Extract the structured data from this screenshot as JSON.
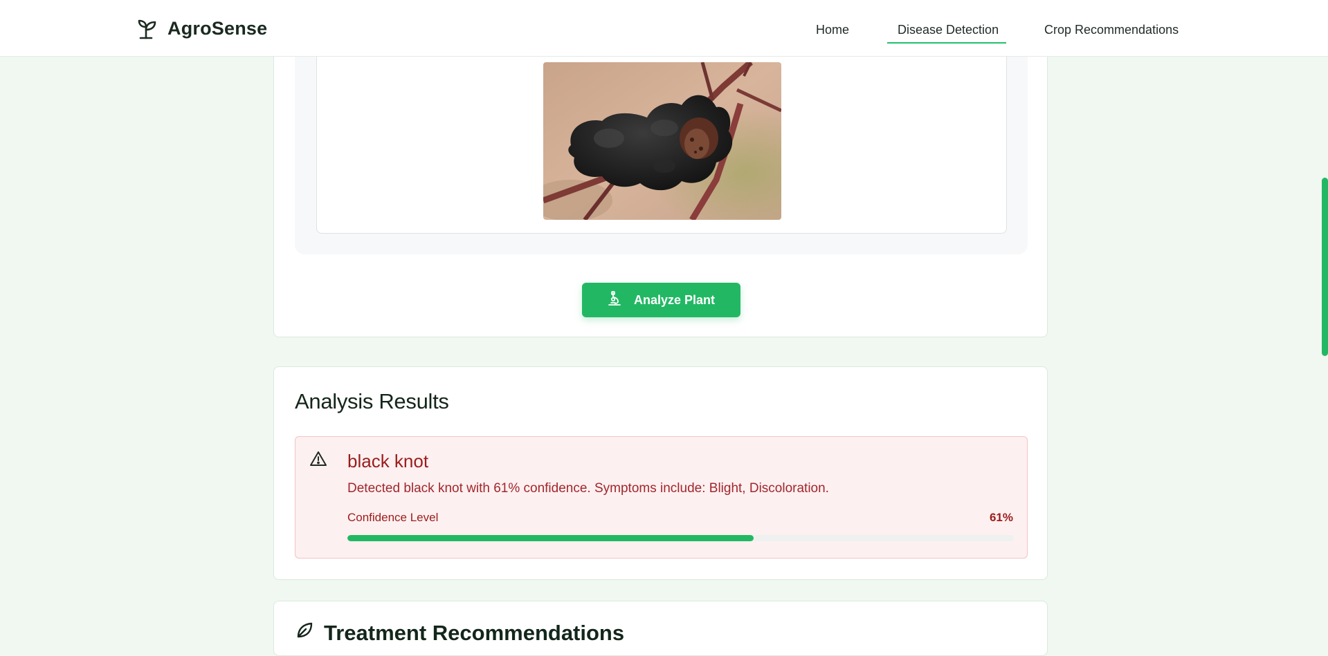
{
  "navbar": {
    "brand": "AgroSense",
    "links": [
      {
        "label": "Home"
      },
      {
        "label": "Disease Detection",
        "active": true
      },
      {
        "label": "Crop Recommendations"
      }
    ]
  },
  "upload": {
    "preview_alt": "black knot plant image",
    "analyze_button": "Analyze Plant",
    "analyze_icon": "microscope-icon"
  },
  "results": {
    "title": "Analysis Results",
    "alert_icon": "warning-triangle-icon",
    "disease_name": "black knot",
    "description": "Detected black knot with 61% confidence. Symptoms include: Blight, Discoloration.",
    "confidence_label": "Confidence Level",
    "confidence_text": "61%",
    "confidence": 0.61
  },
  "treatment": {
    "title": "Treatment Recommendations",
    "icon": "leaf-icon"
  },
  "colors": {
    "accent": "#22b863",
    "page_bg": "#f0f8f1",
    "danger_text": "#9b1c1c",
    "danger_bg": "#fdf0f0",
    "danger_border": "#f4c3c6"
  }
}
